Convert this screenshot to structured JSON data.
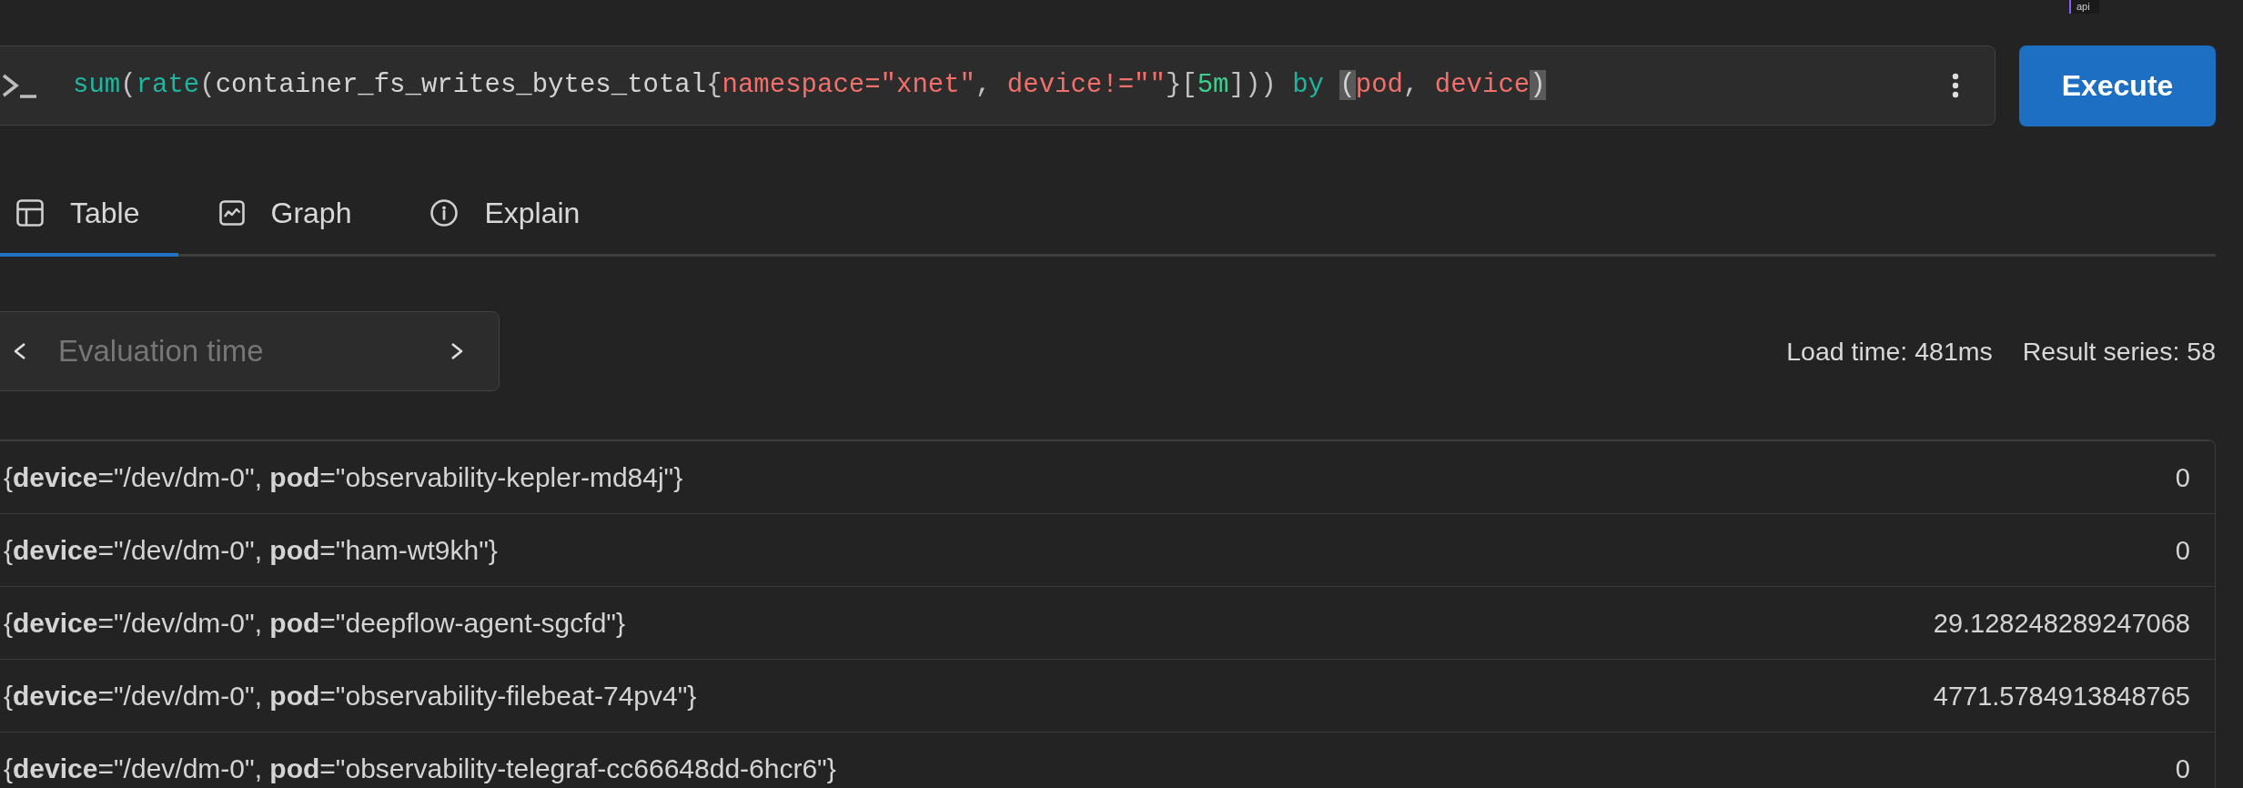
{
  "tooltip_fragment": {
    "text": "api"
  },
  "query": {
    "segments": [
      {
        "kind": "function",
        "text": "sum"
      },
      {
        "kind": "punct",
        "text": "("
      },
      {
        "kind": "function",
        "text": "rate"
      },
      {
        "kind": "punct",
        "text": "("
      },
      {
        "kind": "metric",
        "text": "container_fs_writes_bytes_total"
      },
      {
        "kind": "punct",
        "text": "{"
      },
      {
        "kind": "label",
        "text": "namespace"
      },
      {
        "kind": "operator",
        "text": "="
      },
      {
        "kind": "string",
        "text": "\"xnet\""
      },
      {
        "kind": "punct",
        "text": ", "
      },
      {
        "kind": "label",
        "text": "device"
      },
      {
        "kind": "operator",
        "text": "!="
      },
      {
        "kind": "string",
        "text": "\"\""
      },
      {
        "kind": "punct",
        "text": "}["
      },
      {
        "kind": "duration",
        "text": "5m"
      },
      {
        "kind": "punct",
        "text": "])) "
      },
      {
        "kind": "keyword",
        "text": "by "
      },
      {
        "kind": "bracket_match",
        "text": "("
      },
      {
        "kind": "label",
        "text": "pod"
      },
      {
        "kind": "punct",
        "text": ", "
      },
      {
        "kind": "label",
        "text": "device"
      },
      {
        "kind": "bracket_match",
        "text": ")"
      }
    ]
  },
  "execute_button": {
    "label": "Execute"
  },
  "tabs": [
    {
      "label": "Table",
      "kind": "table",
      "selected": true
    },
    {
      "label": "Graph",
      "kind": "graph",
      "selected": false
    },
    {
      "label": "Explain",
      "kind": "info",
      "selected": false
    }
  ],
  "evaluation_time": {
    "placeholder": "Evaluation time"
  },
  "stats": [
    "Load time: 481ms",
    "Result series: 58"
  ],
  "table": {
    "rows": [
      {
        "series": "{**device**=\"/dev/dm-0\", **pod**=\"observability-kepler-md84j\"}",
        "value": "0"
      },
      {
        "series": "{**device**=\"/dev/dm-0\", **pod**=\"ham-wt9kh\"}",
        "value": "0"
      },
      {
        "series": "{**device**=\"/dev/dm-0\", **pod**=\"deepflow-agent-sgcfd\"}",
        "value": "29.128248289247068"
      },
      {
        "series": "{**device**=\"/dev/dm-0\", **pod**=\"observability-filebeat-74pv4\"}",
        "value": "4771.5784913848765"
      },
      {
        "series": "{**device**=\"/dev/dm-0\", **pod**=\"observability-telegraf-cc66648dd-6hcr6\"}",
        "value": "0"
      }
    ]
  }
}
